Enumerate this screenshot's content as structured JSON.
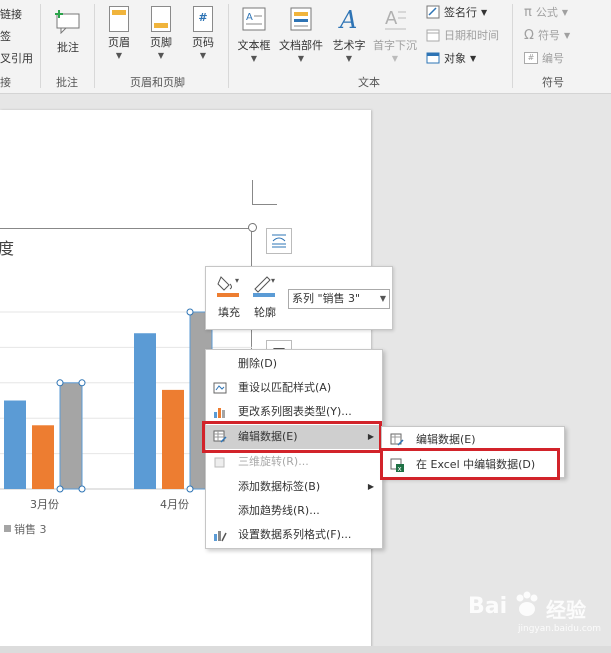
{
  "ribbon": {
    "left_partial": [
      "链接",
      "签",
      "叉引用",
      "接"
    ],
    "comment": {
      "label": "批注",
      "group": "批注"
    },
    "header_footer": {
      "items": [
        "页眉",
        "页脚",
        "页码"
      ],
      "group": "页眉和页脚"
    },
    "text_group": {
      "items": [
        "文本框",
        "文档部件",
        "艺术字",
        "首字下沉"
      ],
      "small": [
        "签名行",
        "日期和时间",
        "对象"
      ],
      "group": "文本"
    },
    "symbols": {
      "small": [
        "公式",
        "符号",
        "编号"
      ],
      "group": "符号"
    }
  },
  "chart": {
    "title_partial": "度",
    "legend_partial": "销售 3"
  },
  "chart_data": {
    "type": "bar",
    "categories": [
      "3月份",
      "4月份"
    ],
    "series": [
      {
        "values": [
          2.5,
          4.4
        ]
      },
      {
        "values": [
          1.8,
          2.8
        ]
      },
      {
        "name": "销售 3",
        "values": [
          3.0,
          5.0
        ]
      }
    ],
    "ylim": [
      0,
      5.0
    ],
    "grid": true,
    "colors": [
      "#5b9bd5",
      "#ed7d31",
      "#a5a5a5"
    ]
  },
  "mini_toolbar": {
    "fill_label": "填充",
    "outline_label": "轮廓",
    "series_value": "系列 \"销售 3\""
  },
  "context_menu": {
    "items": [
      {
        "label": "删除(D)"
      },
      {
        "label": "重设以匹配样式(A)"
      },
      {
        "label": "更改系列图表类型(Y)..."
      },
      {
        "label": "编辑数据(E)"
      },
      {
        "label": "三维旋转(R)..."
      },
      {
        "label": "添加数据标签(B)"
      },
      {
        "label": "添加趋势线(R)..."
      },
      {
        "label": "设置数据系列格式(F)..."
      }
    ]
  },
  "submenu": {
    "items": [
      {
        "label": "编辑数据(E)"
      },
      {
        "label": "在 Excel 中编辑数据(D)"
      }
    ]
  },
  "watermark": {
    "main": "Bai",
    "cn": "经验",
    "sub": "jingyan.baidu.com"
  },
  "colors": {
    "highlight": "#d2232a",
    "accent_blue": "#2e74b5"
  }
}
